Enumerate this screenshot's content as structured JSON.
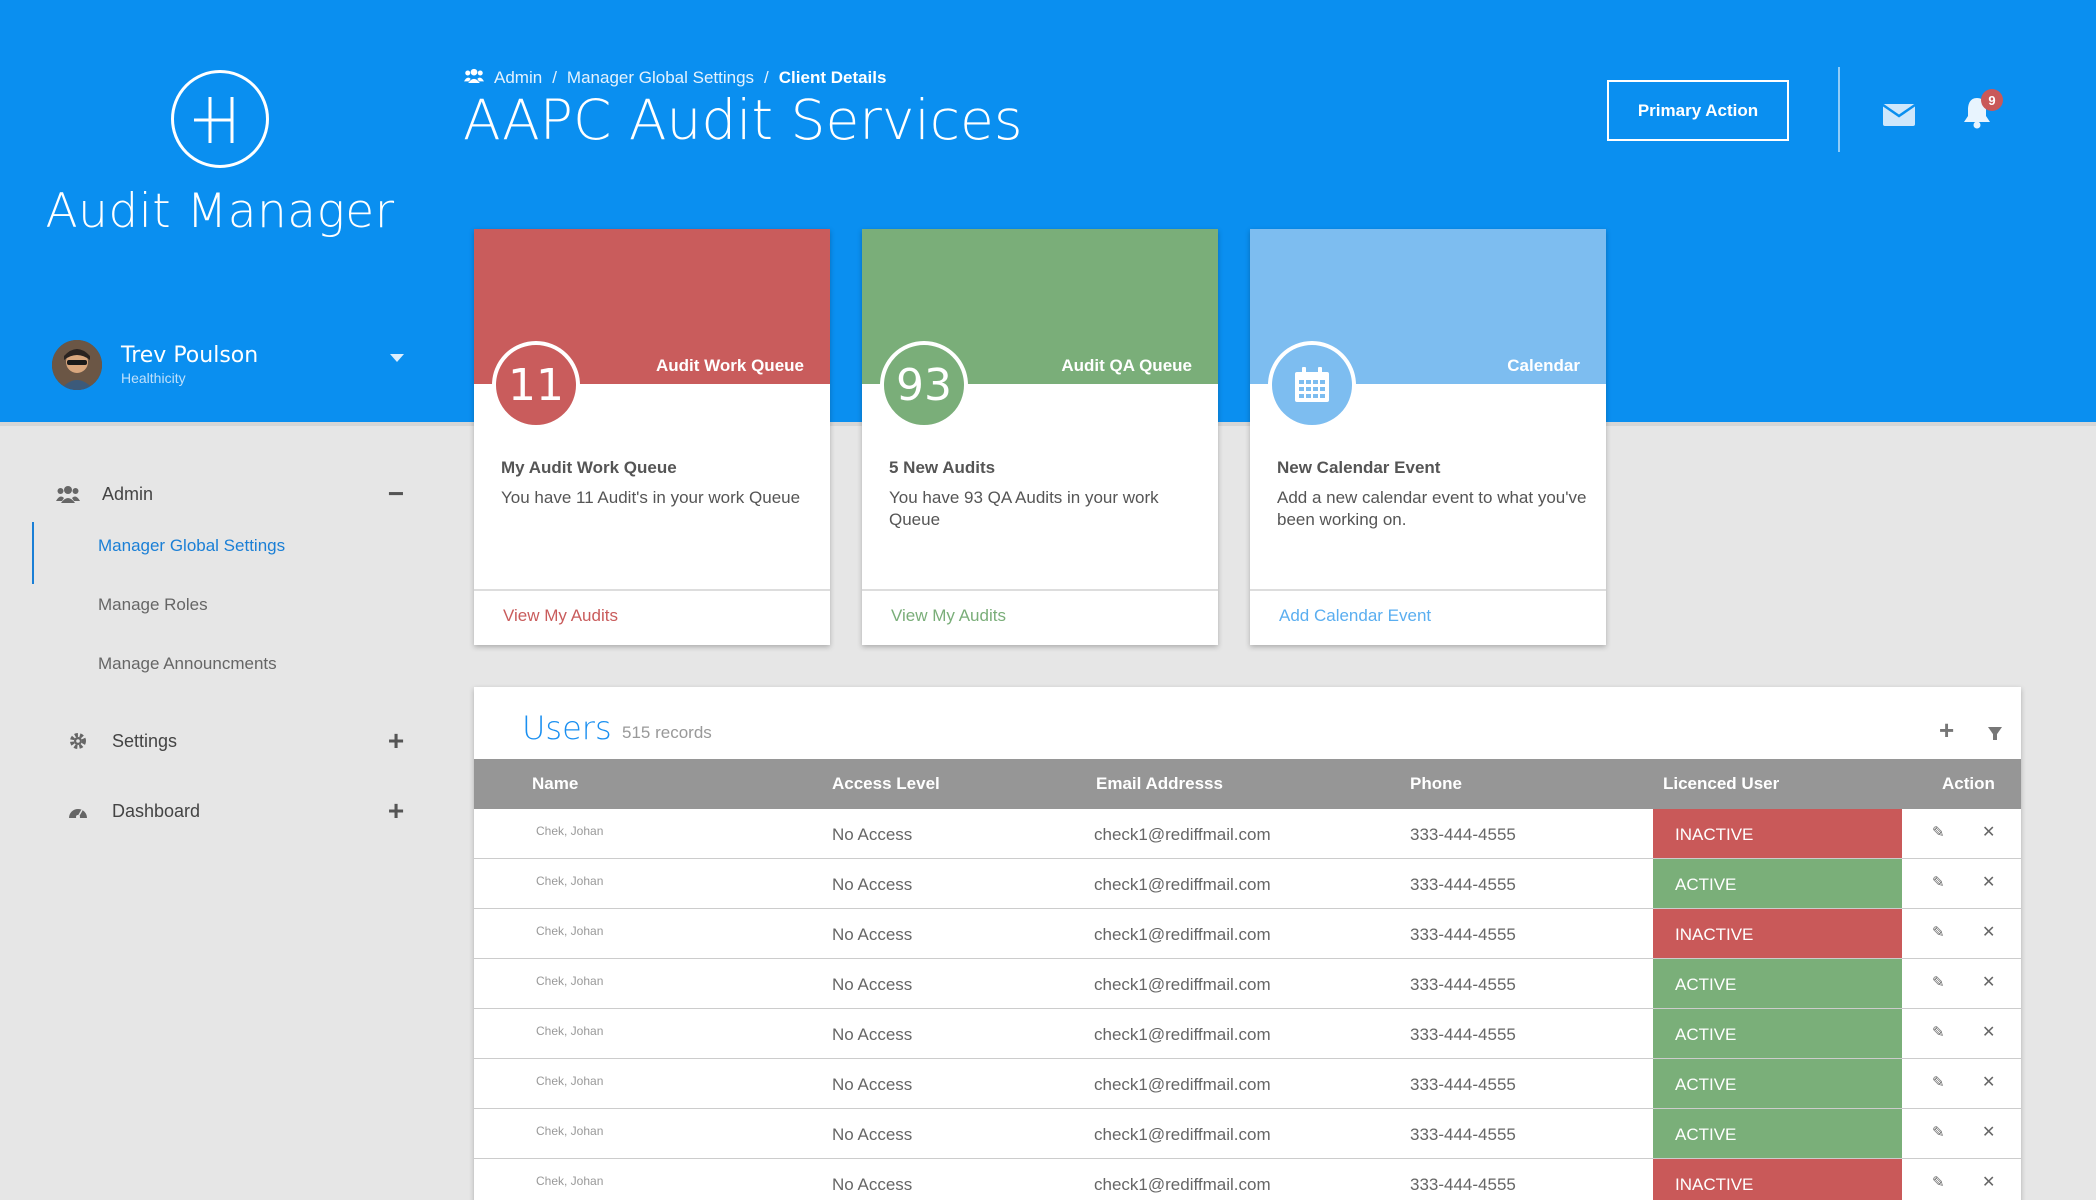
{
  "app": {
    "title": "Audit Manager",
    "brand_color": "#0a8ff0"
  },
  "user": {
    "name": "Trev Poulson",
    "org": "Healthicity"
  },
  "sidebar": {
    "groups": [
      {
        "label": "Admin",
        "icon": "users-icon",
        "toggle": "−",
        "expanded": true
      },
      {
        "label": "Settings",
        "icon": "gear-icon",
        "toggle": "+",
        "expanded": false
      },
      {
        "label": "Dashboard",
        "icon": "dashboard-icon",
        "toggle": "+",
        "expanded": false
      }
    ],
    "admin_items": [
      {
        "label": "Manager Global Settings",
        "active": true
      },
      {
        "label": "Manage Roles",
        "active": false
      },
      {
        "label": "Manage Announcments",
        "active": false
      }
    ]
  },
  "header": {
    "breadcrumb": [
      "Admin",
      "Manager Global Settings",
      "Client Details"
    ],
    "breadcrumb_sep": "/",
    "title": "AAPC Audit Services",
    "primary_action": "Primary Action",
    "notification_count": "9"
  },
  "cards": [
    {
      "label": "Audit Work Queue",
      "number": "11",
      "title": "My Audit Work Queue",
      "body": "You have 11 Audit's in your work Queue",
      "link": "View My Audits",
      "color": "#c95c5c"
    },
    {
      "label": "Audit QA Queue",
      "number": "93",
      "title": "5 New Audits",
      "body": "You have 93 QA Audits in your work Queue",
      "link": "View My Audits",
      "color": "#7aae79"
    },
    {
      "label": "Calendar",
      "icon": "calendar-icon",
      "title": "New Calendar Event",
      "body": "Add a new calendar event to what you've been working on.",
      "link": "Add Calendar Event",
      "color": "#7dbdf0"
    }
  ],
  "users": {
    "title": "Users",
    "count": "515 records",
    "columns": [
      "Name",
      "Access Level",
      "Email Addresss",
      "Phone",
      "Licenced User",
      "Action"
    ],
    "status_colors": {
      "INACTIVE": "#c95959",
      "ACTIVE": "#7aaf79"
    },
    "rows": [
      {
        "name": "Chek, Johan",
        "access": "No Access",
        "email": "check1@rediffmail.com",
        "phone": "333-444-4555",
        "status": "INACTIVE"
      },
      {
        "name": "Chek, Johan",
        "access": "No Access",
        "email": "check1@rediffmail.com",
        "phone": "333-444-4555",
        "status": "ACTIVE"
      },
      {
        "name": "Chek, Johan",
        "access": "No Access",
        "email": "check1@rediffmail.com",
        "phone": "333-444-4555",
        "status": "INACTIVE"
      },
      {
        "name": "Chek, Johan",
        "access": "No Access",
        "email": "check1@rediffmail.com",
        "phone": "333-444-4555",
        "status": "ACTIVE"
      },
      {
        "name": "Chek, Johan",
        "access": "No Access",
        "email": "check1@rediffmail.com",
        "phone": "333-444-4555",
        "status": "ACTIVE"
      },
      {
        "name": "Chek, Johan",
        "access": "No Access",
        "email": "check1@rediffmail.com",
        "phone": "333-444-4555",
        "status": "ACTIVE"
      },
      {
        "name": "Chek, Johan",
        "access": "No Access",
        "email": "check1@rediffmail.com",
        "phone": "333-444-4555",
        "status": "ACTIVE"
      },
      {
        "name": "Chek, Johan",
        "access": "No Access",
        "email": "check1@rediffmail.com",
        "phone": "333-444-4555",
        "status": "INACTIVE"
      }
    ]
  }
}
